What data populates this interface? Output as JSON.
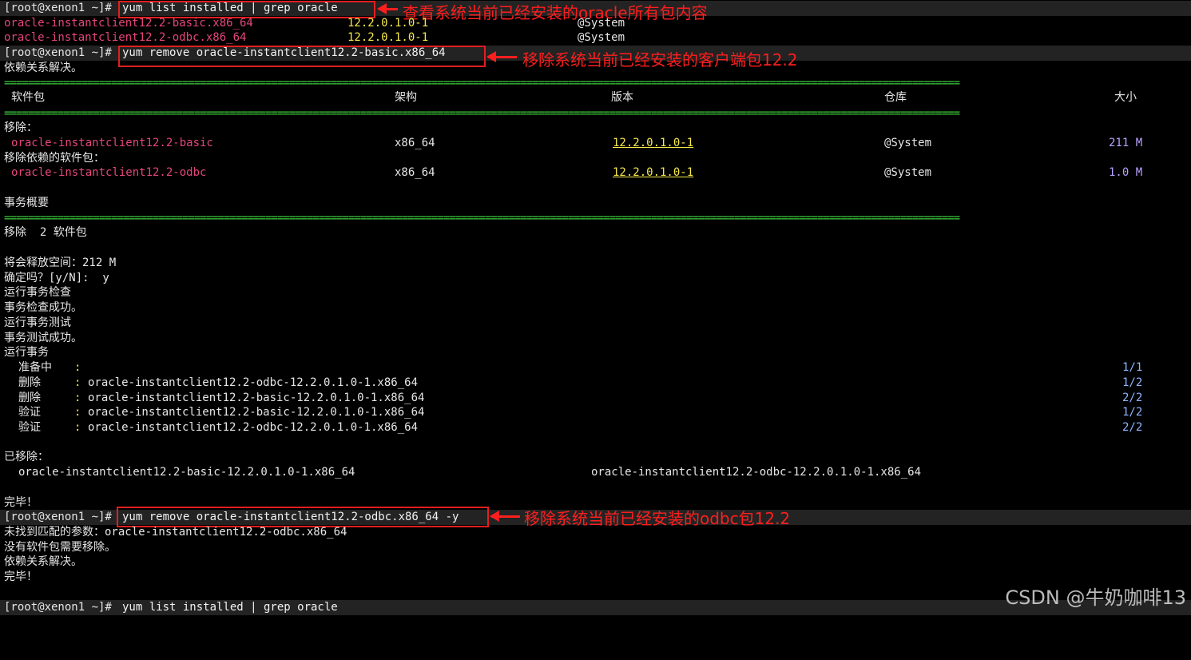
{
  "prompt": "[root@xenon1 ~]#",
  "commands": {
    "list": "yum list installed | grep oracle",
    "remove_basic": "yum remove oracle-instantclient12.2-basic.x86_64",
    "remove_odbc": "yum remove oracle-instantclient12.2-odbc.x86_64 -y"
  },
  "grep_results": [
    {
      "pkg": "oracle-instantclient12.2-basic.x86_64",
      "ver": "12.2.0.1.0-1",
      "repo": "@System"
    },
    {
      "pkg": "oracle-instantclient12.2-odbc.x86_64",
      "ver": "12.2.0.1.0-1",
      "repo": "@System"
    }
  ],
  "annotations": {
    "a1": "查看系统当前已经安装的oracle所有包内容",
    "a2": "移除系统当前已经安装的客户端包12.2",
    "a3": "移除系统当前已经安装的odbc包12.2"
  },
  "deps_resolved": "依赖关系解决。",
  "table_header": {
    "pkg": "软件包",
    "arch": "架构",
    "ver": "版本",
    "repo": "仓库",
    "size": "大小"
  },
  "removing_label": "移除：",
  "removing_deps_label": "移除依赖的软件包：",
  "removing_rows": [
    {
      "pkg": "oracle-instantclient12.2-basic",
      "arch": "x86_64",
      "ver": "12.2.0.1.0-1",
      "repo": "@System",
      "size": "211 M"
    },
    {
      "pkg": "oracle-instantclient12.2-odbc",
      "arch": "x86_64",
      "ver": "12.2.0.1.0-1",
      "repo": "@System",
      "size": "1.0 M"
    }
  ],
  "summary_title": "事务概要",
  "summary_remove": "移除  2 软件包",
  "free_space": "将会释放空间：212 M",
  "confirm": "确定吗？[y/N]:  y",
  "transaction_lines": [
    "运行事务检查",
    "事务检查成功。",
    "运行事务测试",
    "事务测试成功。",
    "运行事务"
  ],
  "steps": [
    {
      "label": "准备中",
      "item": "",
      "count": "1/1"
    },
    {
      "label": "删除",
      "item": "oracle-instantclient12.2-odbc-12.2.0.1.0-1.x86_64",
      "count": "1/2"
    },
    {
      "label": "删除",
      "item": "oracle-instantclient12.2-basic-12.2.0.1.0-1.x86_64",
      "count": "2/2"
    },
    {
      "label": "验证",
      "item": "oracle-instantclient12.2-basic-12.2.0.1.0-1.x86_64",
      "count": "1/2"
    },
    {
      "label": "验证",
      "item": "oracle-instantclient12.2-odbc-12.2.0.1.0-1.x86_64",
      "count": "2/2"
    }
  ],
  "removed_label": "已移除：",
  "removed_items": [
    "oracle-instantclient12.2-basic-12.2.0.1.0-1.x86_64",
    "oracle-instantclient12.2-odbc-12.2.0.1.0-1.x86_64"
  ],
  "done": "完毕！",
  "odbc_output": [
    "未找到匹配的参数：oracle-instantclient12.2-odbc.x86_64",
    "没有软件包需要移除。",
    "依赖关系解决。",
    "完毕！"
  ],
  "watermark": "CSDN @牛奶咖啡13",
  "colors": {
    "annotation": "#ff1e1e",
    "separator": "#3ecf3e",
    "package": "#e5467a",
    "version": "#f6e94a",
    "number": "#b7a1ff",
    "prompt_bg": "#232323"
  }
}
